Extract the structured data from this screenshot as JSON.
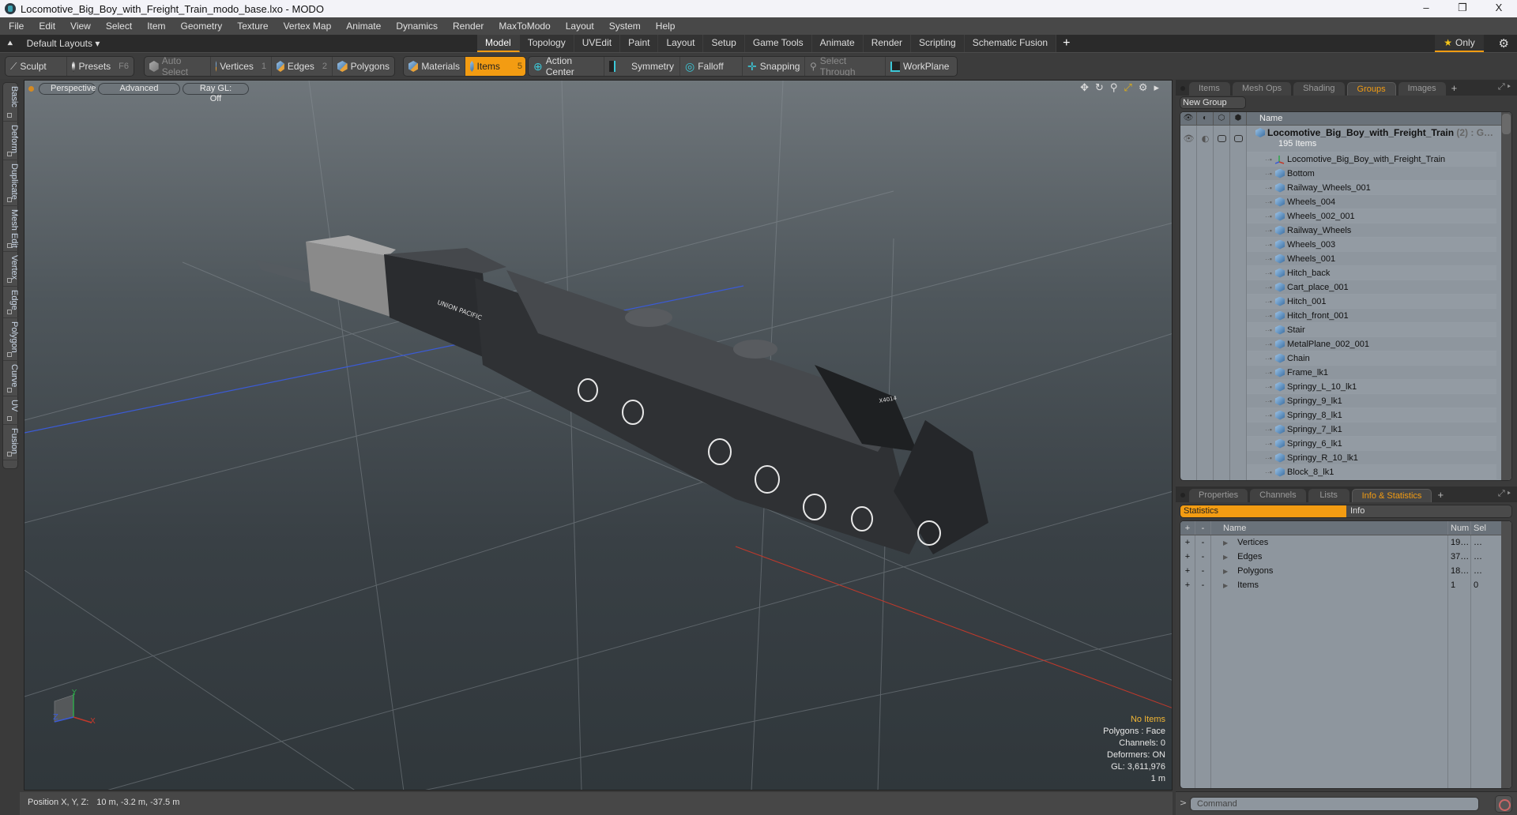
{
  "window": {
    "title": "Locomotive_Big_Boy_with_Freight_Train_modo_base.lxo - MODO",
    "controls": {
      "minimize": "–",
      "maximize": "❐",
      "close": "X"
    }
  },
  "menu": [
    "File",
    "Edit",
    "View",
    "Select",
    "Item",
    "Geometry",
    "Texture",
    "Vertex Map",
    "Animate",
    "Dynamics",
    "Render",
    "MaxToModo",
    "Layout",
    "System",
    "Help"
  ],
  "layout_bar": {
    "layouts_label": "Default Layouts ▾",
    "tabs": [
      {
        "label": "Model",
        "active": true
      },
      {
        "label": "Topology",
        "active": false
      },
      {
        "label": "UVEdit",
        "active": false
      },
      {
        "label": "Paint",
        "active": false
      },
      {
        "label": "Layout",
        "active": false
      },
      {
        "label": "Setup",
        "active": false
      },
      {
        "label": "Game Tools",
        "active": false
      },
      {
        "label": "Animate",
        "active": false
      },
      {
        "label": "Render",
        "active": false
      },
      {
        "label": "Scripting",
        "active": false
      },
      {
        "label": "Schematic Fusion",
        "active": false
      }
    ],
    "add_tab": "+",
    "only_label": "Only"
  },
  "toolbar": {
    "sculpt": "Sculpt",
    "presets": "Presets",
    "presets_key": "F6",
    "auto_select": "Auto Select",
    "vertices": "Vertices",
    "vertices_key": "1",
    "edges": "Edges",
    "edges_key": "2",
    "polygons": "Polygons",
    "materials": "Materials",
    "items": "Items",
    "items_key": "5",
    "action_center": "Action Center",
    "symmetry": "Symmetry",
    "falloff": "Falloff",
    "snapping": "Snapping",
    "select_through": "Select Through",
    "workplane": "WorkPlane"
  },
  "left_tabs": [
    "Basic",
    "Deform",
    "Duplicate",
    "Mesh Edit",
    "Vertex",
    "Edge",
    "Polygon",
    "Curve",
    "UV",
    "Fusion"
  ],
  "viewport": {
    "view_mode": "Perspective",
    "shading": "Advanced",
    "raygl": "Ray GL: Off",
    "info": {
      "selection": "No Items",
      "polygons": "Polygons : Face",
      "channels": "Channels: 0",
      "deformers": "Deformers: ON",
      "gl": "GL: 3,611,976",
      "scale": "1 m"
    },
    "axis_labels": {
      "x": "X",
      "y": "Y",
      "z": "Z"
    },
    "colors": {
      "x_axis": "#c0392b",
      "z_axis": "#3b5bd6",
      "y_axis": "#2ea84a"
    }
  },
  "status_bar": {
    "label": "Position X, Y, Z:",
    "value": "10 m, -3.2 m, -37.5 m"
  },
  "groups_panel": {
    "tabs": [
      {
        "label": "Items",
        "active": false
      },
      {
        "label": "Mesh Ops",
        "active": false
      },
      {
        "label": "Shading",
        "active": false
      },
      {
        "label": "Groups",
        "active": true
      },
      {
        "label": "Images",
        "active": false
      }
    ],
    "new_group": "New Group",
    "column_name": "Name",
    "group": {
      "name": "Locomotive_Big_Boy_with_Freight_Train",
      "suffix": "(2) : G…",
      "count": "195 Items"
    },
    "items": [
      {
        "name": "Locomotive_Big_Boy_with_Freight_Train",
        "type": "locator"
      },
      {
        "name": "Bottom",
        "type": "mesh"
      },
      {
        "name": "Railway_Wheels_001",
        "type": "mesh"
      },
      {
        "name": "Wheels_004",
        "type": "mesh"
      },
      {
        "name": "Wheels_002_001",
        "type": "mesh"
      },
      {
        "name": "Railway_Wheels",
        "type": "mesh"
      },
      {
        "name": "Wheels_003",
        "type": "mesh"
      },
      {
        "name": "Wheels_001",
        "type": "mesh"
      },
      {
        "name": "Hitch_back",
        "type": "mesh"
      },
      {
        "name": "Cart_place_001",
        "type": "mesh"
      },
      {
        "name": "Hitch_001",
        "type": "mesh"
      },
      {
        "name": "Hitch_front_001",
        "type": "mesh"
      },
      {
        "name": "Stair",
        "type": "mesh"
      },
      {
        "name": "MetalPlane_002_001",
        "type": "mesh"
      },
      {
        "name": "Chain",
        "type": "mesh"
      },
      {
        "name": "Frame_lk1",
        "type": "mesh"
      },
      {
        "name": "Springy_L_10_lk1",
        "type": "mesh"
      },
      {
        "name": "Springy_9_lk1",
        "type": "mesh"
      },
      {
        "name": "Springy_8_lk1",
        "type": "mesh"
      },
      {
        "name": "Springy_7_lk1",
        "type": "mesh"
      },
      {
        "name": "Springy_6_lk1",
        "type": "mesh"
      },
      {
        "name": "Springy_R_10_lk1",
        "type": "mesh"
      },
      {
        "name": "Block_8_lk1",
        "type": "mesh"
      }
    ]
  },
  "stats_panel": {
    "tabs": [
      {
        "label": "Properties",
        "active": false
      },
      {
        "label": "Channels",
        "active": false
      },
      {
        "label": "Lists",
        "active": false
      },
      {
        "label": "Info & Statistics",
        "active": true
      }
    ],
    "subtabs": {
      "statistics": "Statistics",
      "info": "Info"
    },
    "columns": {
      "add": "+",
      "remove": "-",
      "name": "Name",
      "num": "Num",
      "sel": "Sel"
    },
    "rows": [
      {
        "name": "Vertices",
        "num": "19…",
        "sel": "…"
      },
      {
        "name": "Edges",
        "num": "37…",
        "sel": "…"
      },
      {
        "name": "Polygons",
        "num": "18…",
        "sel": "…"
      },
      {
        "name": "Items",
        "num": "1",
        "sel": "0"
      }
    ]
  },
  "command": {
    "prompt": ">",
    "placeholder": "Command"
  },
  "accent_color": "#f39c12"
}
